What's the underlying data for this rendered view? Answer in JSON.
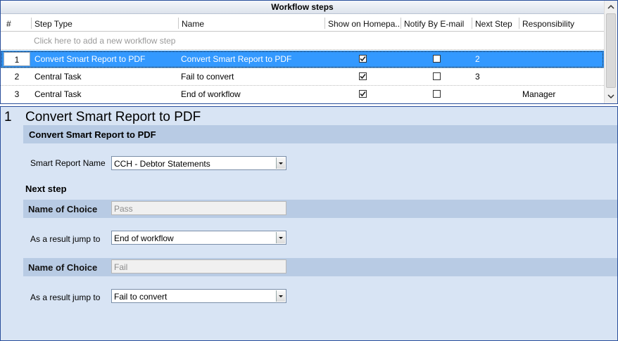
{
  "grid": {
    "title": "Workflow steps",
    "columns": [
      "#",
      "Step Type",
      "Name",
      "Show on  Homepa...",
      "Notify By E-mail",
      "Next Step",
      "Responsibility"
    ],
    "new_row_placeholder": "Click here to add a new workflow step",
    "rows": [
      {
        "num": "1",
        "step_type": "Convert Smart Report to PDF",
        "name": "Convert Smart Report to PDF",
        "show_on_homepage": true,
        "notify_by_email": false,
        "next_step": "2",
        "responsibility": "",
        "selected": true
      },
      {
        "num": "2",
        "step_type": "Central Task",
        "name": "Fail to convert",
        "show_on_homepage": true,
        "notify_by_email": false,
        "next_step": "3",
        "responsibility": "",
        "selected": false
      },
      {
        "num": "3",
        "step_type": "Central Task",
        "name": "End of workflow",
        "show_on_homepage": true,
        "notify_by_email": false,
        "next_step": "",
        "responsibility": "Manager",
        "selected": false
      }
    ]
  },
  "detail": {
    "step_number": "1",
    "step_title": "Convert Smart Report to PDF",
    "section_title": "Convert Smart Report to PDF",
    "smart_report_label": "Smart Report Name",
    "smart_report_value": "CCH - Debtor Statements",
    "next_step_heading": "Next step",
    "choices": [
      {
        "name_label": "Name of Choice",
        "name_value": "Pass",
        "jump_label": "As a result jump to",
        "jump_value": "End of workflow"
      },
      {
        "name_label": "Name of Choice",
        "name_value": "Fail",
        "jump_label": "As a result jump to",
        "jump_value": "Fail to convert"
      }
    ]
  },
  "colors": {
    "selection": "#3399ff",
    "panel_border": "#2a4f9b",
    "detail_bg": "#d8e4f4",
    "band_bg": "#b8cbe4"
  },
  "icons": {
    "check": "checkmark-icon",
    "dropdown": "chevron-down-icon",
    "scroll_up": "scroll-up-arrow-icon",
    "scroll_down": "scroll-down-arrow-icon"
  }
}
